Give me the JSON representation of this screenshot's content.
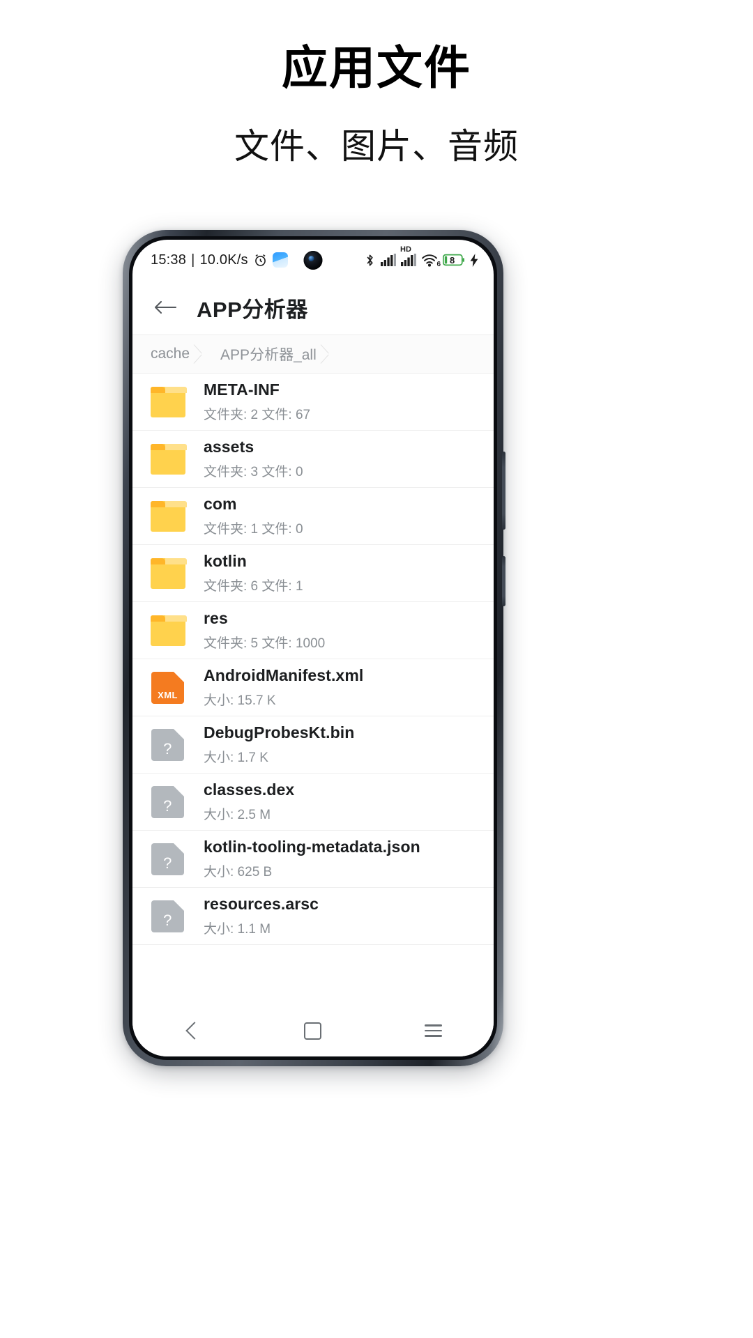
{
  "promo": {
    "title": "应用文件",
    "subtitle": "文件、图片、音频"
  },
  "status_bar": {
    "time": "15:38",
    "separator": "|",
    "network_speed": "10.0K/s",
    "alarm_icon": "alarm-clock-icon",
    "app_icon": "blue-app-icon",
    "bluetooth_icon": "bluetooth-icon",
    "signal_icon": "cellular-signal-icon",
    "hd_label": "HD",
    "hd_signal_icon": "cellular-signal-hd-icon",
    "wifi_icon": "wifi-6-icon",
    "wifi_generation": "6",
    "battery_level": "8",
    "charging_icon": "charging-bolt-icon"
  },
  "app_bar": {
    "back_icon": "back-arrow-icon",
    "title": "APP分析器"
  },
  "breadcrumb": {
    "items": [
      {
        "label": "cache"
      },
      {
        "label": "APP分析器_all"
      }
    ]
  },
  "file_list": {
    "folder_label": "文件夹:",
    "file_label": "文件:",
    "size_label": "大小:",
    "rows": [
      {
        "name": "META-INF",
        "meta": "文件夹: 2 文件: 67",
        "icon": "folder-icon",
        "type": "folder"
      },
      {
        "name": "assets",
        "meta": "文件夹: 3 文件: 0",
        "icon": "folder-icon",
        "type": "folder"
      },
      {
        "name": "com",
        "meta": "文件夹: 1 文件: 0",
        "icon": "folder-icon",
        "type": "folder"
      },
      {
        "name": "kotlin",
        "meta": "文件夹: 6 文件: 1",
        "icon": "folder-icon",
        "type": "folder"
      },
      {
        "name": "res",
        "meta": "文件夹: 5 文件: 1000",
        "icon": "folder-icon",
        "type": "folder"
      },
      {
        "name": "AndroidManifest.xml",
        "meta": "大小: 15.7 K",
        "icon": "xml-file-icon",
        "type": "xml",
        "badge": "XML"
      },
      {
        "name": "DebugProbesKt.bin",
        "meta": "大小: 1.7 K",
        "icon": "unknown-file-icon",
        "type": "unknown",
        "badge": "?"
      },
      {
        "name": "classes.dex",
        "meta": "大小: 2.5 M",
        "icon": "unknown-file-icon",
        "type": "unknown",
        "badge": "?"
      },
      {
        "name": "kotlin-tooling-metadata.json",
        "meta": "大小: 625 B",
        "icon": "unknown-file-icon",
        "type": "unknown",
        "badge": "?"
      },
      {
        "name": "resources.arsc",
        "meta": "大小: 1.1 M",
        "icon": "unknown-file-icon",
        "type": "unknown",
        "badge": "?"
      }
    ]
  },
  "nav_bar": {
    "back_icon": "nav-back-icon",
    "home_icon": "nav-home-icon",
    "recents_icon": "nav-menu-icon"
  },
  "colors": {
    "folder_yellow": "#ffd24d",
    "folder_tab": "#ffb629",
    "xml_orange": "#f47b20",
    "unknown_gray": "#b3b8bd",
    "text_primary": "#1c1e20",
    "text_secondary": "#8a8f94"
  }
}
